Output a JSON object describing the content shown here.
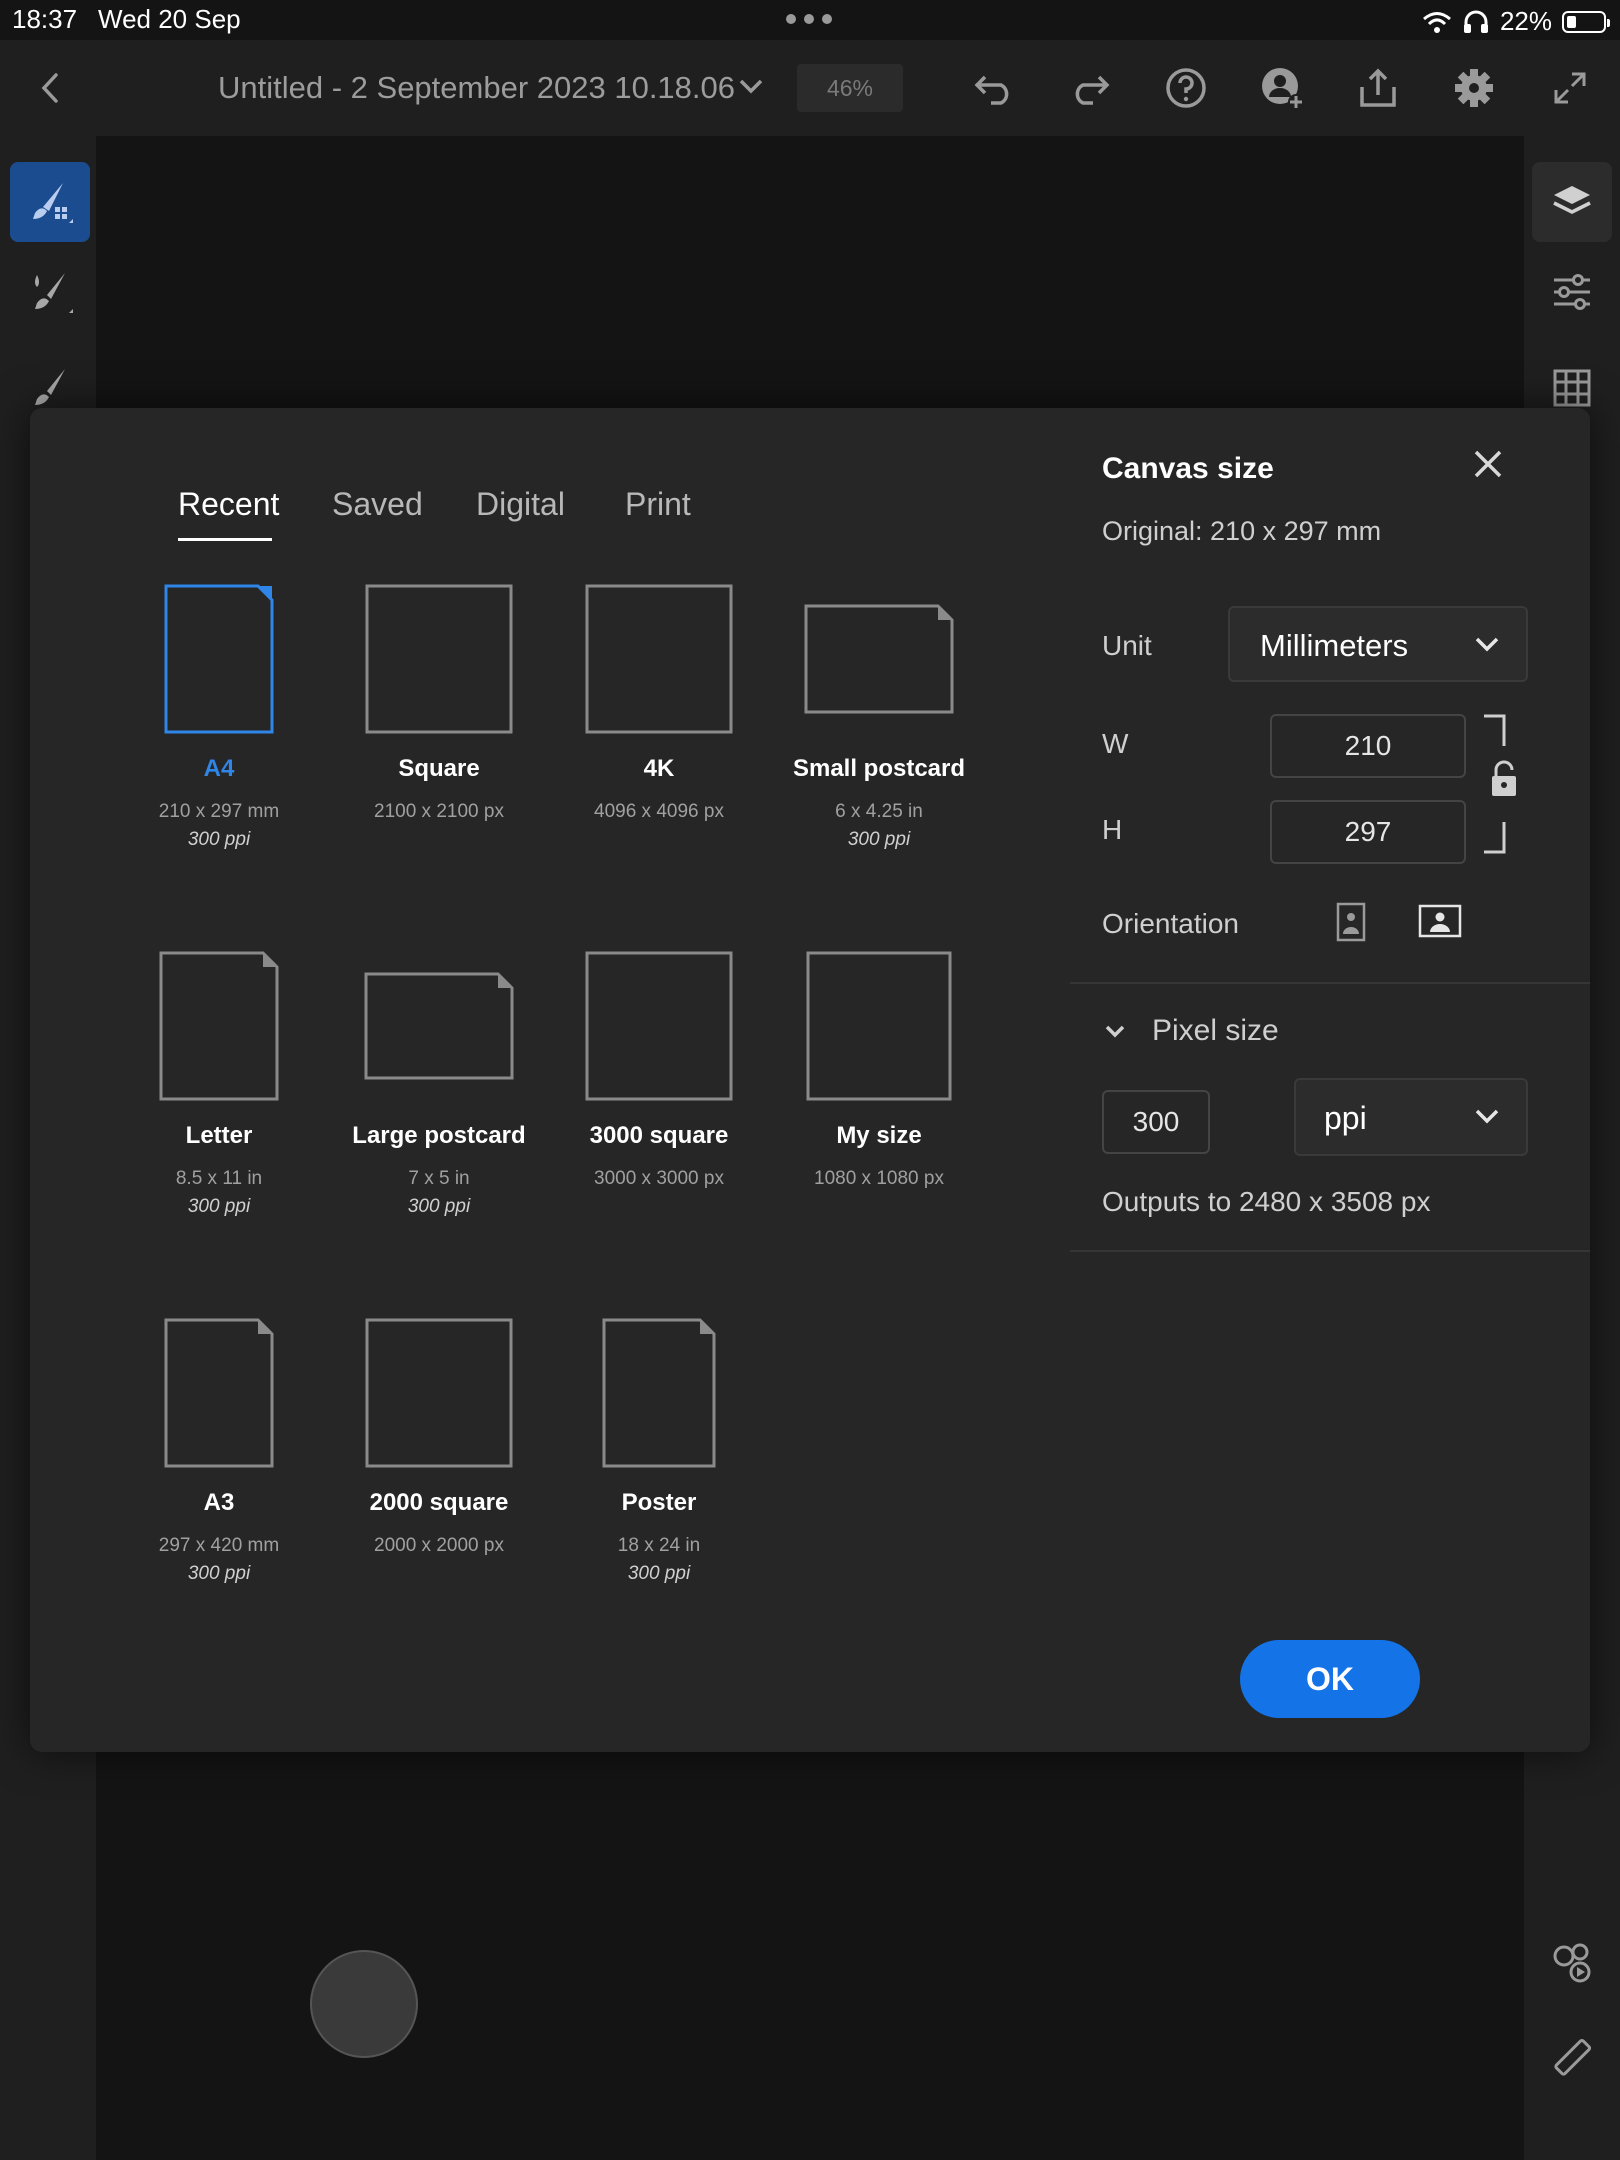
{
  "status_bar": {
    "time": "18:37",
    "date": "Wed 20 Sep",
    "battery": "22%",
    "battery_level": 0.22
  },
  "toolbar": {
    "document_title": "Untitled - 2 September 2023 10.18.06",
    "zoom": "46%",
    "icons": [
      "back-icon",
      "undo-icon",
      "redo-icon",
      "help-icon",
      "invite-icon",
      "share-icon",
      "settings-icon",
      "fullscreen-icon"
    ]
  },
  "dialog": {
    "tabs": [
      {
        "label": "Recent",
        "active": true
      },
      {
        "label": "Saved",
        "active": false
      },
      {
        "label": "Digital",
        "active": false
      },
      {
        "label": "Print",
        "active": false
      }
    ],
    "presets": [
      {
        "name": "A4",
        "dims": "210 x 297 mm",
        "ppi": "300 ppi",
        "selected": true
      },
      {
        "name": "Square",
        "dims": "2100 x 2100 px",
        "ppi": ""
      },
      {
        "name": "4K",
        "dims": "4096 x 4096 px",
        "ppi": ""
      },
      {
        "name": "Small postcard",
        "dims": "6 x 4.25 in",
        "ppi": "300 ppi"
      },
      {
        "name": "Letter",
        "dims": "8.5 x 11 in",
        "ppi": "300 ppi"
      },
      {
        "name": "Large postcard",
        "dims": "7 x 5 in",
        "ppi": "300 ppi"
      },
      {
        "name": "3000 square",
        "dims": "3000 x 3000 px",
        "ppi": ""
      },
      {
        "name": "My size",
        "dims": "1080 x 1080 px",
        "ppi": ""
      },
      {
        "name": "A3",
        "dims": "297 x 420 mm",
        "ppi": "300 ppi"
      },
      {
        "name": "2000 square",
        "dims": "2000 x 2000 px",
        "ppi": ""
      },
      {
        "name": "Poster",
        "dims": "18 x 24 in",
        "ppi": "300 ppi"
      }
    ],
    "canvas_size": {
      "title": "Canvas size",
      "original": "Original: 210 x 297 mm",
      "unit_label": "Unit",
      "unit_value": "Millimeters",
      "width_label": "W",
      "width_value": "210",
      "height_label": "H",
      "height_value": "297",
      "orientation_label": "Orientation",
      "pixel_size_label": "Pixel size",
      "resolution_value": "300",
      "resolution_unit": "ppi",
      "outputs": "Outputs to 2480 x 3508 px"
    },
    "ok_label": "OK"
  },
  "colors": {
    "accent": "#1473e6",
    "selected_text": "#2f86e8",
    "dialog_bg": "#262626",
    "app_bg": "#141414"
  }
}
